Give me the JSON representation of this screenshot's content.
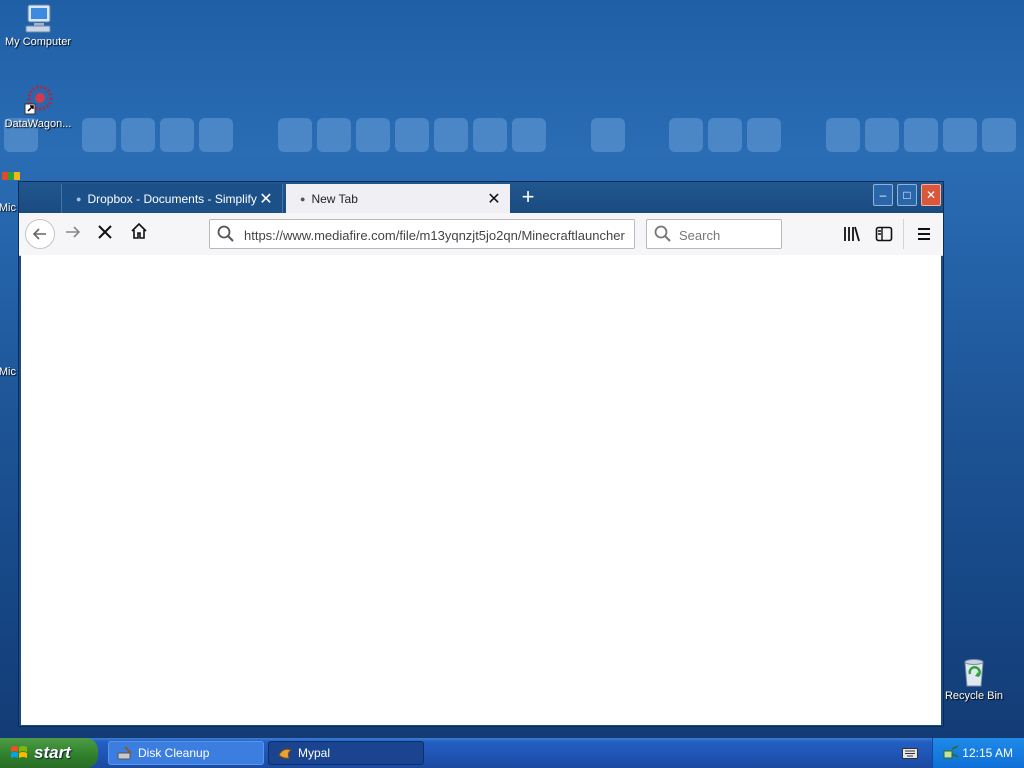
{
  "desktop": {
    "icons": [
      {
        "label": "My Computer"
      },
      {
        "label": "DataWagon..."
      },
      {
        "label": "Mic"
      },
      {
        "label": "Mic"
      },
      {
        "label": "Recycle Bin"
      }
    ]
  },
  "browser": {
    "tabs": [
      {
        "title": "Dropbox - Documents - Simplify yo",
        "active": false
      },
      {
        "title": "New Tab",
        "active": true
      }
    ],
    "url": "https://www.mediafire.com/file/m13yqnzjt5jo2qn/Minecraftlauncher",
    "search_placeholder": "Search",
    "controls": {
      "minimize": "–",
      "maximize": "□",
      "close": "✕"
    }
  },
  "taskbar": {
    "start_label": "start",
    "items": [
      {
        "label": "Disk Cleanup",
        "active": false
      },
      {
        "label": "Mypal",
        "active": true
      }
    ],
    "clock": "12:15 AM"
  }
}
